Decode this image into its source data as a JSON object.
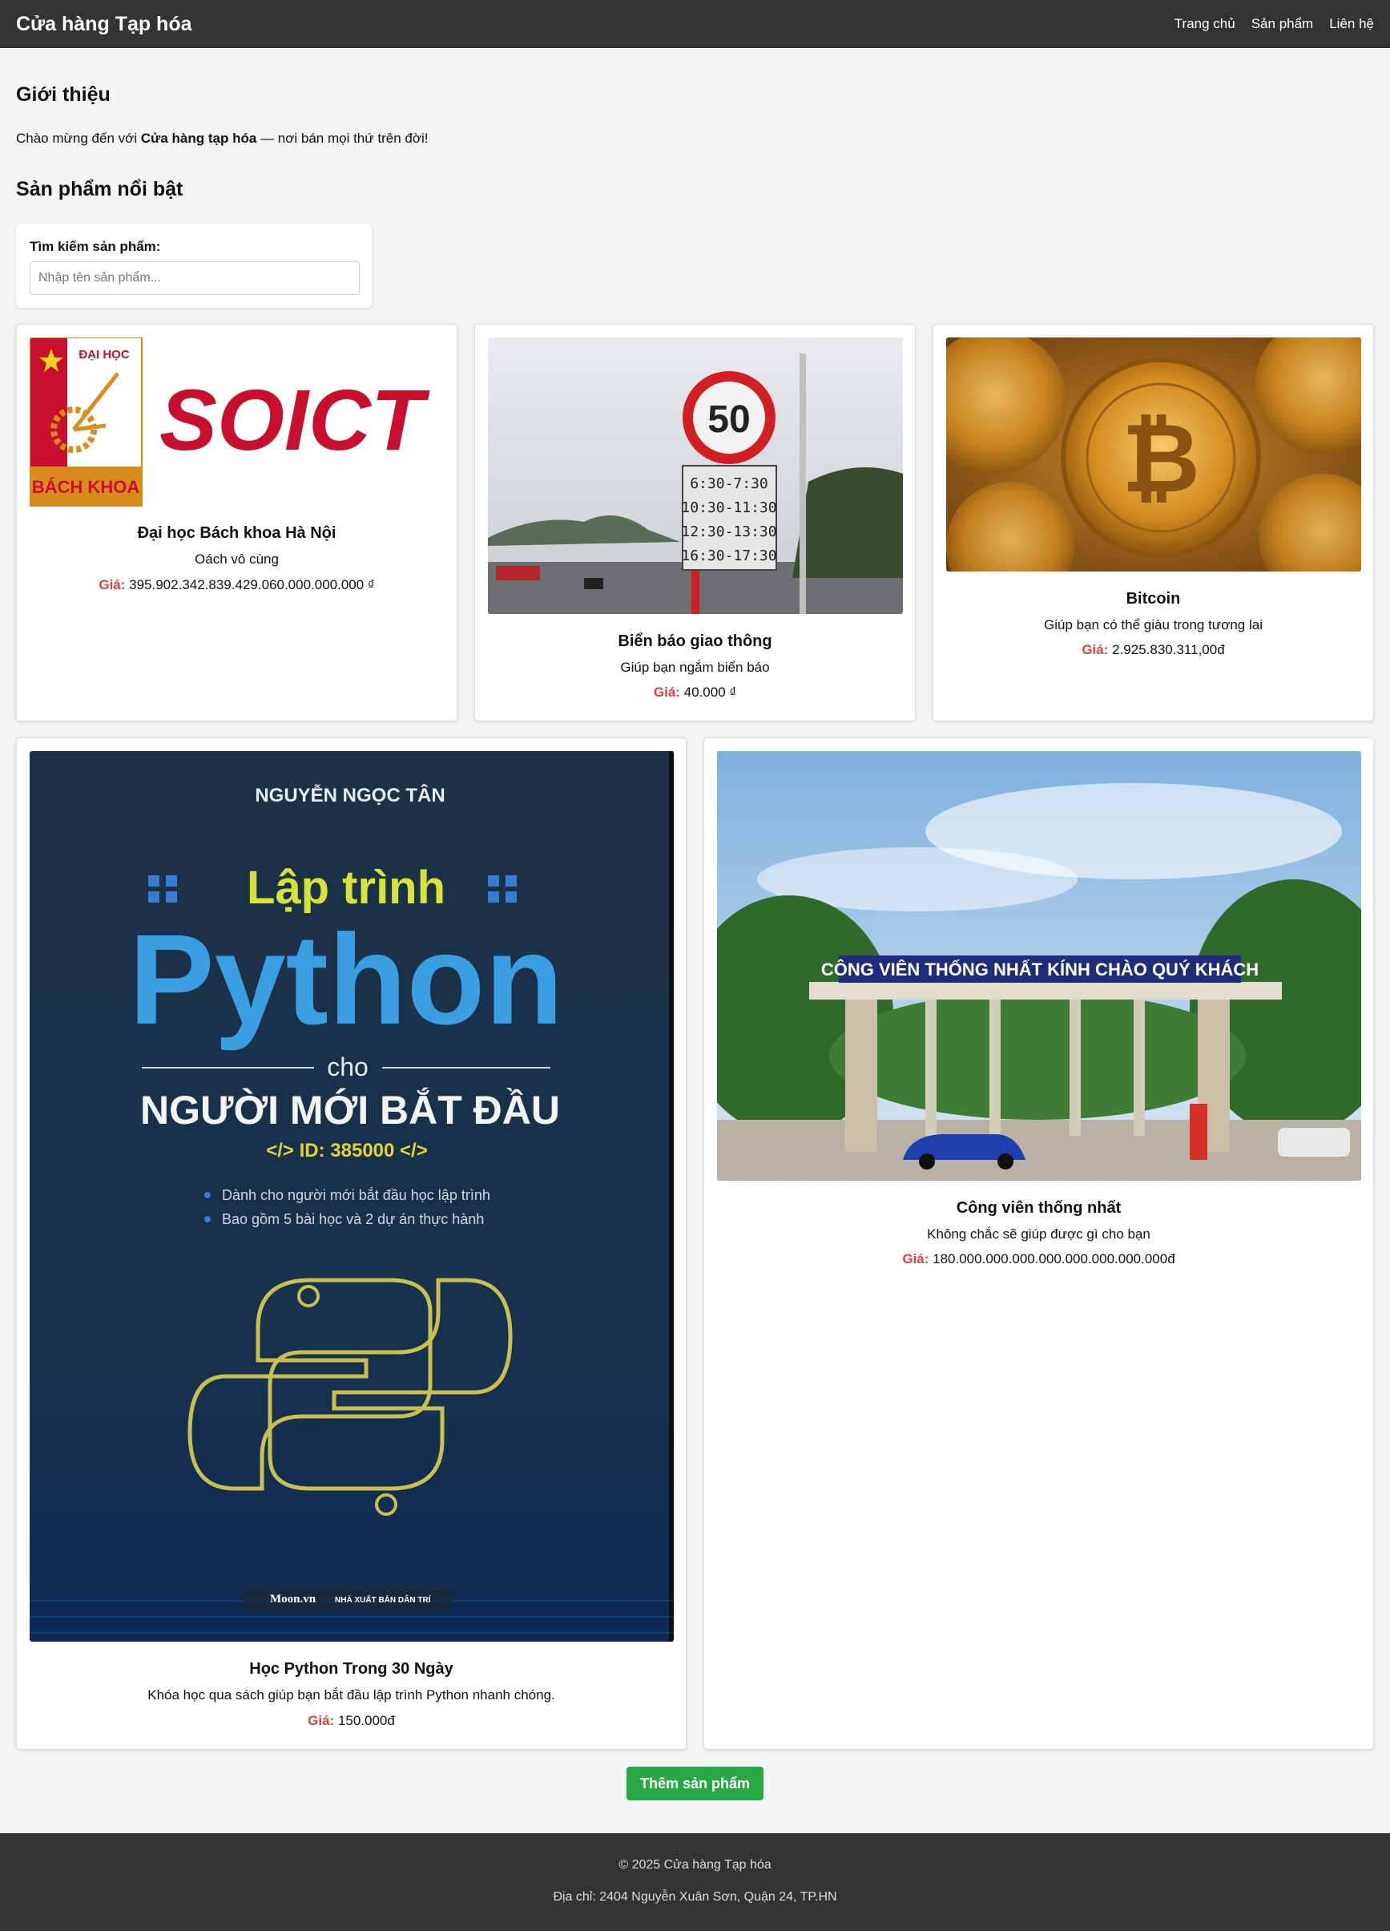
{
  "header": {
    "brand": "Cửa hàng Tạp hóa",
    "nav": [
      "Trang chủ",
      "Sản phẩm",
      "Liên hệ"
    ]
  },
  "intro": {
    "heading": "Giới thiệu",
    "text_before": "Chào mừng đến với ",
    "text_bold": "Cửa hàng tạp hóa",
    "text_after": " — nơi bán mọi thứ trên đời!"
  },
  "featured": {
    "heading": "Sản phẩm nổi bật",
    "search_label": "Tìm kiếm sản phẩm:",
    "search_placeholder": "Nhập tên sản phẩm...",
    "price_label": "Giá:"
  },
  "products": [
    {
      "name": "Đại học Bách khoa Hà Nội",
      "desc": "Oách vô cùng",
      "price": "395.902.342.839.429.060.000.000.000 ₫",
      "image": {
        "logo_top_text": "ĐẠI HỌC",
        "logo_bottom_text": "BÁCH KHOA",
        "wordmark": "SOICT"
      }
    },
    {
      "name": "Biển báo giao thông",
      "desc": "Giúp bạn ngắm biển báo",
      "price": "40.000 ₫",
      "image": {
        "speed_limit": "50",
        "time_rows": [
          "6:30-7:30",
          "10:30-11:30",
          "12:30-13:30",
          "16:30-17:30"
        ]
      }
    },
    {
      "name": "Bitcoin",
      "desc": "Giúp bạn có thể giàu trong tương lai",
      "price": "2.925.830.311,00đ",
      "image": {
        "symbol": "₿"
      }
    },
    {
      "name": "Học Python Trong 30 Ngày",
      "desc": "Khóa học qua sách giúp bạn bắt đầu lập trình Python nhanh chóng.",
      "price": "150.000đ",
      "image": {
        "author": "NGUYỄN NGỌC TÂN",
        "title_top": "Lập trình",
        "title_main": "Python",
        "title_cho": "cho",
        "title_sub": "NGƯỜI MỚI BẮT ĐẦU",
        "book_id": "</> ID: 385000 </>",
        "bullets": [
          "Dành cho người mới bắt đầu học lập trình",
          "Bao gồm 5 bài học và 2 dự án thực hành"
        ],
        "publisher_left": "Moon.vn",
        "publisher_right": "NHÀ XUẤT BẢN DÂN TRÍ"
      }
    },
    {
      "name": "Công viên thống nhất",
      "desc": "Không chắc sẽ giúp được gì cho bạn",
      "price": "180.000.000.000.000.000.000.000.000đ",
      "image": {
        "gate_banner": "CÔNG VIÊN THỐNG NHẤT KÍNH CHÀO QUÝ KHÁCH"
      }
    }
  ],
  "add_button": "Thêm sản phẩm",
  "footer": {
    "copyright": "© 2025 Cửa hàng Tạp hóa",
    "address": "Địa chỉ: 2404 Nguyễn Xuân Sơn, Quận 24, TP.HN"
  }
}
